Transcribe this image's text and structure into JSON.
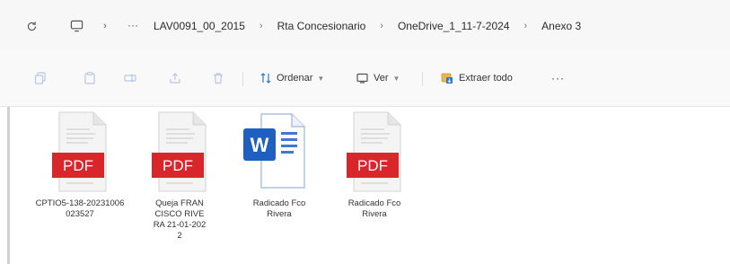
{
  "address_bar": {
    "refresh_icon": "refresh-icon",
    "computer_icon": "computer-icon",
    "overflow_label": "···",
    "crumbs": [
      "LAV0091_00_2015",
      "Rta Concesionario",
      "OneDrive_1_11-7-2024",
      "Anexo 3"
    ]
  },
  "command_bar": {
    "icons": [
      "copy-icon",
      "paste-icon",
      "rename-icon",
      "share-icon",
      "delete-icon"
    ],
    "sort_label": "Ordenar",
    "view_label": "Ver",
    "extract_label": "Extraer todo",
    "more_label": "···"
  },
  "files": [
    {
      "name": "CPTIO5-138-20231006023527",
      "type": "pdf",
      "badge": "PDF"
    },
    {
      "name": "Queja FRANCISCO RIVERA 21-01-2022",
      "type": "pdf",
      "badge": "PDF"
    },
    {
      "name": "Radicado Fco Rivera",
      "type": "word",
      "badge": "W"
    },
    {
      "name": "Radicado Fco Rivera",
      "type": "pdf",
      "badge": "PDF"
    }
  ],
  "colors": {
    "pdf_red": "#d9262b",
    "word_blue": "#1f5fbf",
    "accent_blue": "#2b78d6"
  }
}
